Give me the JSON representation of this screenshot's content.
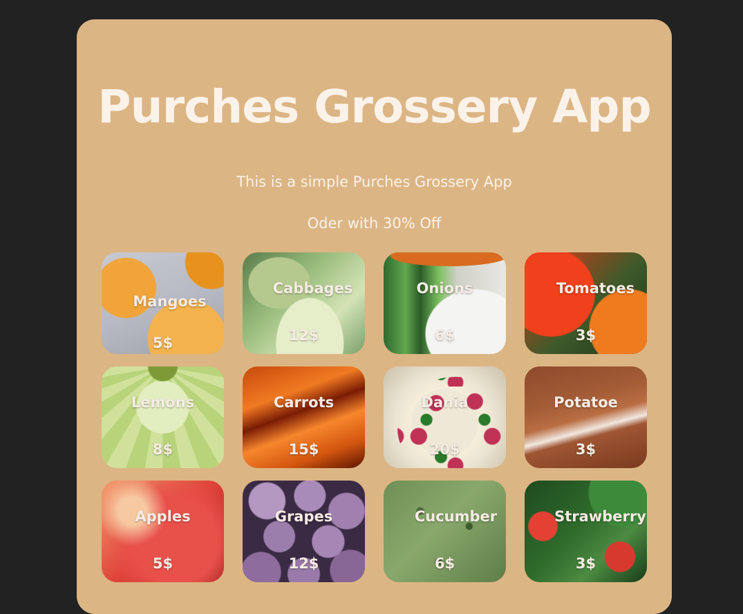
{
  "header": {
    "title": "Purches Grossery App",
    "subtitle": "This is a simple Purches Grossery App",
    "offer": "Oder with 30% Off"
  },
  "products": [
    {
      "name": "Mangoes",
      "price": "5$",
      "icon": "mango-photo"
    },
    {
      "name": "Cabbages",
      "price": "12$",
      "icon": "cabbage-photo"
    },
    {
      "name": "Onions",
      "price": "6$",
      "icon": "onion-photo"
    },
    {
      "name": "Tomatoes",
      "price": "3$",
      "icon": "tomato-photo"
    },
    {
      "name": "Lemons",
      "price": "8$",
      "icon": "lemon-photo"
    },
    {
      "name": "Carrots",
      "price": "15$",
      "icon": "carrot-photo"
    },
    {
      "name": "Dania",
      "price": "20$",
      "icon": "dania-photo"
    },
    {
      "name": "Potatoe",
      "price": "3$",
      "icon": "potato-photo"
    },
    {
      "name": "Apples",
      "price": "5$",
      "icon": "apple-photo"
    },
    {
      "name": "Grapes",
      "price": "12$",
      "icon": "grape-photo"
    },
    {
      "name": "Cucumber",
      "price": "6$",
      "icon": "cucumber-photo"
    },
    {
      "name": "Strawberry",
      "price": "3$",
      "icon": "strawberry-photo"
    }
  ],
  "colors": {
    "page_background": "#222222",
    "card_background": "#dcb584",
    "text": "#fbf2e9"
  }
}
